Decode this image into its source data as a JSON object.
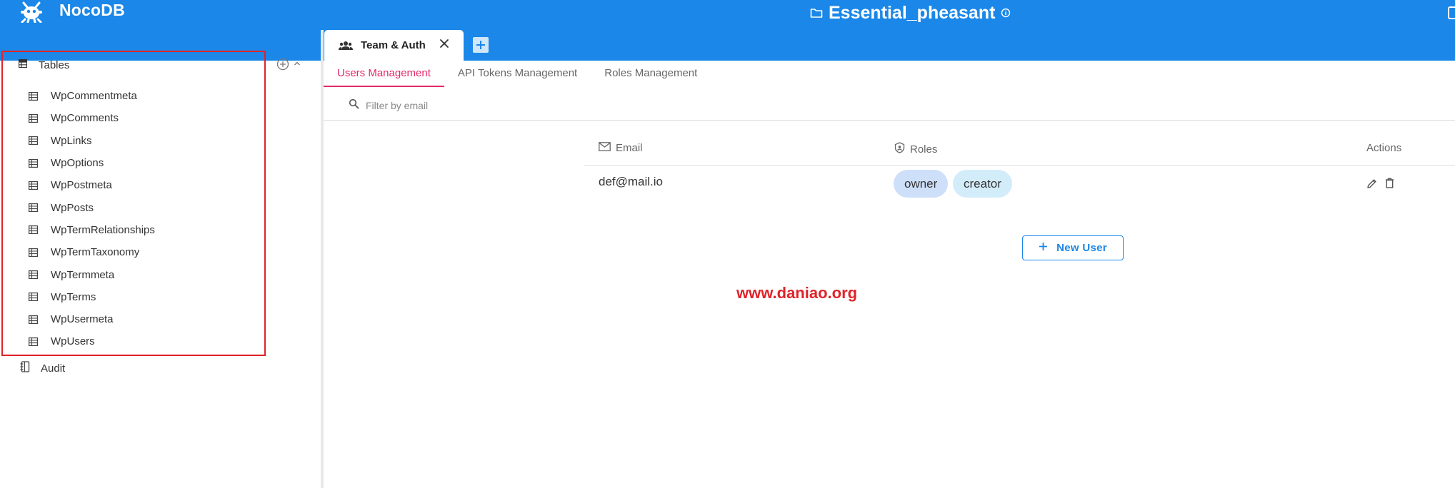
{
  "app": {
    "brand": "NocoDB",
    "project_name": "Essential_pheasant"
  },
  "tabs": {
    "active_tab_label": "Team & Auth"
  },
  "sidebar": {
    "tables_label": "Tables",
    "tables": [
      "WpCommentmeta",
      "WpComments",
      "WpLinks",
      "WpOptions",
      "WpPostmeta",
      "WpPosts",
      "WpTermRelationships",
      "WpTermTaxonomy",
      "WpTermmeta",
      "WpTerms",
      "WpUsermeta",
      "WpUsers"
    ],
    "audit_label": "Audit"
  },
  "subtabs": {
    "users": "Users Management",
    "api_tokens": "API Tokens Management",
    "roles": "Roles Management"
  },
  "filter": {
    "placeholder": "Filter by email"
  },
  "users_table": {
    "headers": {
      "email": "Email",
      "roles": "Roles",
      "actions": "Actions"
    },
    "rows": [
      {
        "email": "def@mail.io",
        "roles": [
          "owner",
          "creator"
        ]
      }
    ]
  },
  "new_user_label": "New User",
  "watermark": "www.daniao.org",
  "colors": {
    "topbar": "#1b87e8",
    "active_subtab": "#e22a66",
    "highlight_border": "#e0232a",
    "chip_owner": "#cedffa",
    "chip_creator": "#d3ecfa"
  }
}
